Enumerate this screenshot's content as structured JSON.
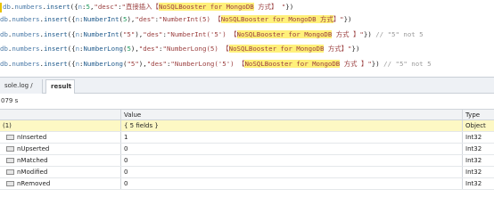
{
  "editor": {
    "lines": [
      {
        "segments": [
          {
            "t": "db",
            "c": "c-obj"
          },
          {
            "t": ".",
            "c": ""
          },
          {
            "t": "numbers",
            "c": "c-obj"
          },
          {
            "t": ".",
            "c": ""
          },
          {
            "t": "insert",
            "c": "c-meth"
          },
          {
            "t": "({",
            "c": ""
          },
          {
            "t": "n",
            "c": "c-key"
          },
          {
            "t": ":",
            "c": ""
          },
          {
            "t": "5",
            "c": "c-num"
          },
          {
            "t": ",",
            "c": ""
          },
          {
            "t": "\"desc\"",
            "c": "c-str"
          },
          {
            "t": ":",
            "c": ""
          },
          {
            "t": "\"直接插入【",
            "c": "c-str"
          },
          {
            "t": "NoSQLBooster for MongoDB",
            "c": "c-str hl"
          },
          {
            "t": " 方式】 \"",
            "c": "c-str"
          },
          {
            "t": "})",
            "c": ""
          }
        ]
      },
      {
        "segments": [
          {
            "t": "db",
            "c": "c-obj"
          },
          {
            "t": ".",
            "c": ""
          },
          {
            "t": "numbers",
            "c": "c-obj"
          },
          {
            "t": ".",
            "c": ""
          },
          {
            "t": "insert",
            "c": "c-meth"
          },
          {
            "t": "({",
            "c": ""
          },
          {
            "t": "n",
            "c": "c-key"
          },
          {
            "t": ":",
            "c": ""
          },
          {
            "t": "NumberInt",
            "c": "c-kw"
          },
          {
            "t": "(",
            "c": ""
          },
          {
            "t": "5",
            "c": "c-num"
          },
          {
            "t": "),",
            "c": ""
          },
          {
            "t": "\"des\"",
            "c": "c-str"
          },
          {
            "t": ":",
            "c": ""
          },
          {
            "t": "\"NumberInt(5) 【",
            "c": "c-str"
          },
          {
            "t": "NoSQLBooster for MongoDB 方式",
            "c": "c-str hl"
          },
          {
            "t": "】\"",
            "c": "c-str"
          },
          {
            "t": "})",
            "c": ""
          }
        ]
      },
      {
        "segments": [
          {
            "t": "db",
            "c": "c-obj"
          },
          {
            "t": ".",
            "c": ""
          },
          {
            "t": "numbers",
            "c": "c-obj"
          },
          {
            "t": ".",
            "c": ""
          },
          {
            "t": "insert",
            "c": "c-meth"
          },
          {
            "t": "({",
            "c": ""
          },
          {
            "t": "n",
            "c": "c-key"
          },
          {
            "t": ":",
            "c": ""
          },
          {
            "t": "NumberInt",
            "c": "c-kw"
          },
          {
            "t": "(",
            "c": ""
          },
          {
            "t": "\"5\"",
            "c": "c-str"
          },
          {
            "t": "),",
            "c": ""
          },
          {
            "t": "\"des\"",
            "c": "c-str"
          },
          {
            "t": ":",
            "c": ""
          },
          {
            "t": "\"NumberInt('5') 【",
            "c": "c-str"
          },
          {
            "t": "NoSQLBooster for MongoDB",
            "c": "c-str hl"
          },
          {
            "t": " 方式 】\"",
            "c": "c-str"
          },
          {
            "t": "}) ",
            "c": ""
          },
          {
            "t": "// \"5\" not 5",
            "c": "c-com"
          }
        ]
      },
      {
        "segments": [
          {
            "t": "db",
            "c": "c-obj"
          },
          {
            "t": ".",
            "c": ""
          },
          {
            "t": "numbers",
            "c": "c-obj"
          },
          {
            "t": ".",
            "c": ""
          },
          {
            "t": "insert",
            "c": "c-meth"
          },
          {
            "t": "({",
            "c": ""
          },
          {
            "t": "n",
            "c": "c-key"
          },
          {
            "t": ":",
            "c": ""
          },
          {
            "t": "NumberLong",
            "c": "c-kw"
          },
          {
            "t": "(",
            "c": ""
          },
          {
            "t": "5",
            "c": "c-num"
          },
          {
            "t": "),",
            "c": ""
          },
          {
            "t": "\"des\"",
            "c": "c-str"
          },
          {
            "t": ":",
            "c": ""
          },
          {
            "t": "\"NumberLong(5) 【",
            "c": "c-str"
          },
          {
            "t": "NoSQLBooster for MongoDB",
            "c": "c-str hl"
          },
          {
            "t": " 方式】\"",
            "c": "c-str"
          },
          {
            "t": "})",
            "c": ""
          }
        ]
      },
      {
        "segments": [
          {
            "t": "db",
            "c": "c-obj"
          },
          {
            "t": ".",
            "c": ""
          },
          {
            "t": "numbers",
            "c": "c-obj"
          },
          {
            "t": ".",
            "c": ""
          },
          {
            "t": "insert",
            "c": "c-meth"
          },
          {
            "t": "({",
            "c": ""
          },
          {
            "t": "n",
            "c": "c-key"
          },
          {
            "t": ":",
            "c": ""
          },
          {
            "t": "NumberLong",
            "c": "c-kw"
          },
          {
            "t": "(",
            "c": ""
          },
          {
            "t": "\"5\"",
            "c": "c-str"
          },
          {
            "t": "),",
            "c": ""
          },
          {
            "t": "\"des\"",
            "c": "c-str"
          },
          {
            "t": ":",
            "c": ""
          },
          {
            "t": "\"NumberLong('5') 【",
            "c": "c-str"
          },
          {
            "t": "NoSQLBooster for MongoDB",
            "c": "c-str hl"
          },
          {
            "t": " 方式 】\"",
            "c": "c-str"
          },
          {
            "t": "}) ",
            "c": ""
          },
          {
            "t": "// \"5\" not 5",
            "c": "c-com"
          }
        ]
      }
    ]
  },
  "tabs": {
    "console_label": "sole.log / print",
    "result_label": "result"
  },
  "status": {
    "elapsed": "079 s"
  },
  "grid": {
    "headers": {
      "key": "",
      "value": "Value",
      "type": "Type"
    },
    "root": {
      "key": "(1)",
      "value": "{ 5 fields }",
      "type": "Object"
    },
    "rows": [
      {
        "key": "nInserted",
        "value": "1",
        "type": "Int32"
      },
      {
        "key": "nUpserted",
        "value": "0",
        "type": "Int32"
      },
      {
        "key": "nMatched",
        "value": "0",
        "type": "Int32"
      },
      {
        "key": "nModified",
        "value": "0",
        "type": "Int32"
      },
      {
        "key": "nRemoved",
        "value": "0",
        "type": "Int32"
      }
    ]
  }
}
